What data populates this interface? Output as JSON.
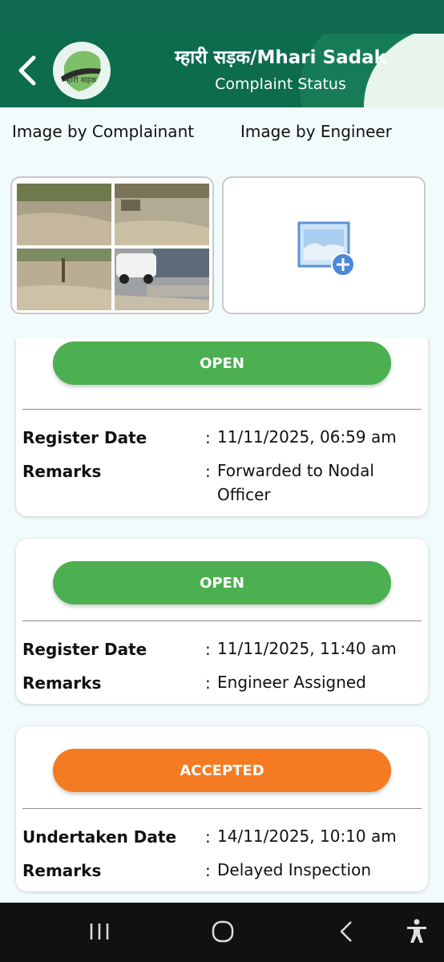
{
  "header": {
    "title": "म्हारी सड़क/Mhari Sadak",
    "subtitle": "Complaint Status",
    "logo_text": "म्हारी सड़क",
    "back_icon": "chevron-left-icon"
  },
  "images": {
    "complainant_label": "Image by Complainant",
    "engineer_label": "Image by Engineer",
    "add_icon": "add-image-icon"
  },
  "status_entries": [
    {
      "status": "OPEN",
      "color": "#4caf50",
      "date_label": "Register Date",
      "date_value": "11/11/2025, 06:59 am",
      "remarks_label": "Remarks",
      "remarks_value": "Forwarded to Nodal Officer"
    },
    {
      "status": "OPEN",
      "color": "#4caf50",
      "date_label": "Register Date",
      "date_value": "11/11/2025, 11:40 am",
      "remarks_label": "Remarks",
      "remarks_value": "Engineer Assigned"
    },
    {
      "status": "ACCEPTED",
      "color": "#f47b22",
      "date_label": "Undertaken Date",
      "date_value": "14/11/2025, 10:10 am",
      "remarks_label": "Remarks",
      "remarks_value": "Delayed Inspection"
    }
  ],
  "colon": ":",
  "colors": {
    "header_bg": "#0d6b4e",
    "accent_green": "#4caf50",
    "accent_orange": "#f47b22",
    "page_bg": "#f1fbfb"
  },
  "nav": {
    "recents_icon": "recents-icon",
    "home_icon": "home-icon",
    "back_icon": "back-icon",
    "accessibility_icon": "accessibility-icon"
  }
}
